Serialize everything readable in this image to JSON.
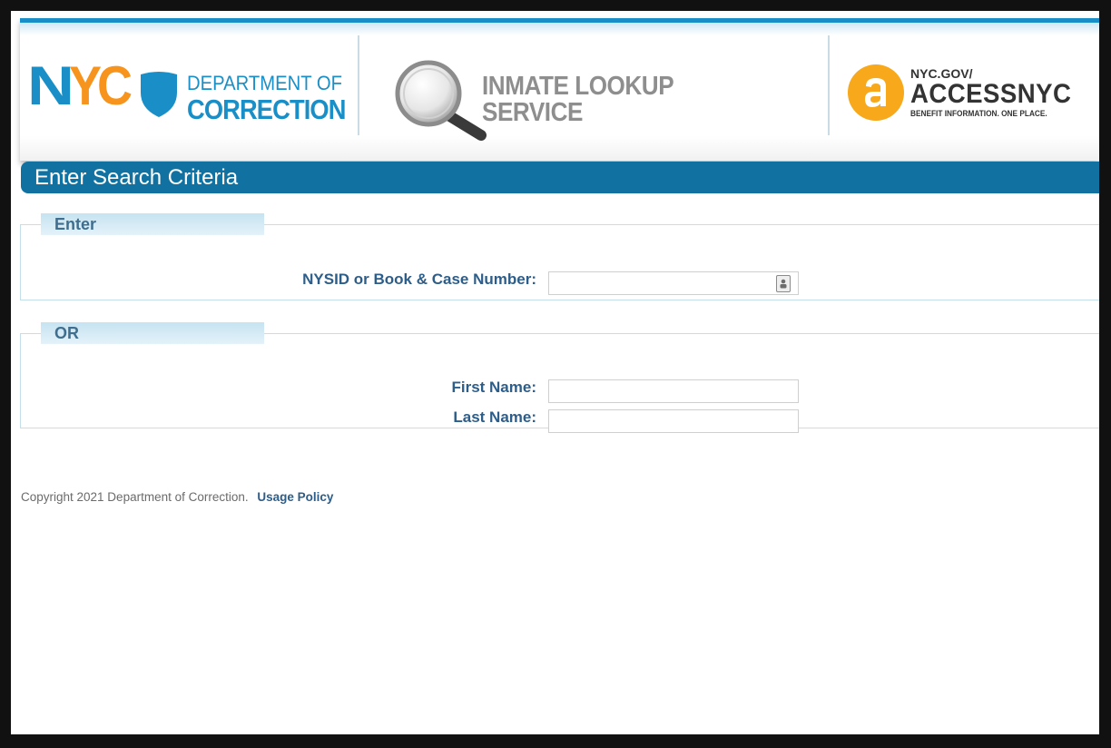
{
  "header": {
    "nyc_logo_text": "NYC",
    "department": {
      "line1": "DEPARTMENT OF",
      "line2": "CORRECTION"
    },
    "service": {
      "line1": "INMATE LOOKUP",
      "line2": "SERVICE"
    },
    "access_nyc": {
      "line1": "NYC.GOV/",
      "line2": "ACCESSNYC",
      "line3": "BENEFIT INFORMATION. ONE PLACE."
    },
    "icons": [
      "nyc-logo",
      "shield-icon",
      "magnifier-icon",
      "access-nyc-icon"
    ]
  },
  "search_bar": {
    "title": "Enter Search Criteria"
  },
  "enter_section": {
    "legend": "Enter",
    "nysid_label": "NYSID or Book & Case Number:",
    "nysid_value": "",
    "nysid_icon": "contact-card-icon"
  },
  "or_section": {
    "legend": "OR",
    "first_name_label": "First Name:",
    "first_name_value": "",
    "last_name_label": "Last Name:",
    "last_name_value": ""
  },
  "footer": {
    "copyright": "Copyright 2021 Department of Correction.",
    "usage_policy": "Usage Policy"
  },
  "colors": {
    "brand_blue": "#1a8fc7",
    "bar_blue": "#1172a1",
    "nyc_orange": "#f7941d",
    "label_blue": "#2d5d89"
  }
}
